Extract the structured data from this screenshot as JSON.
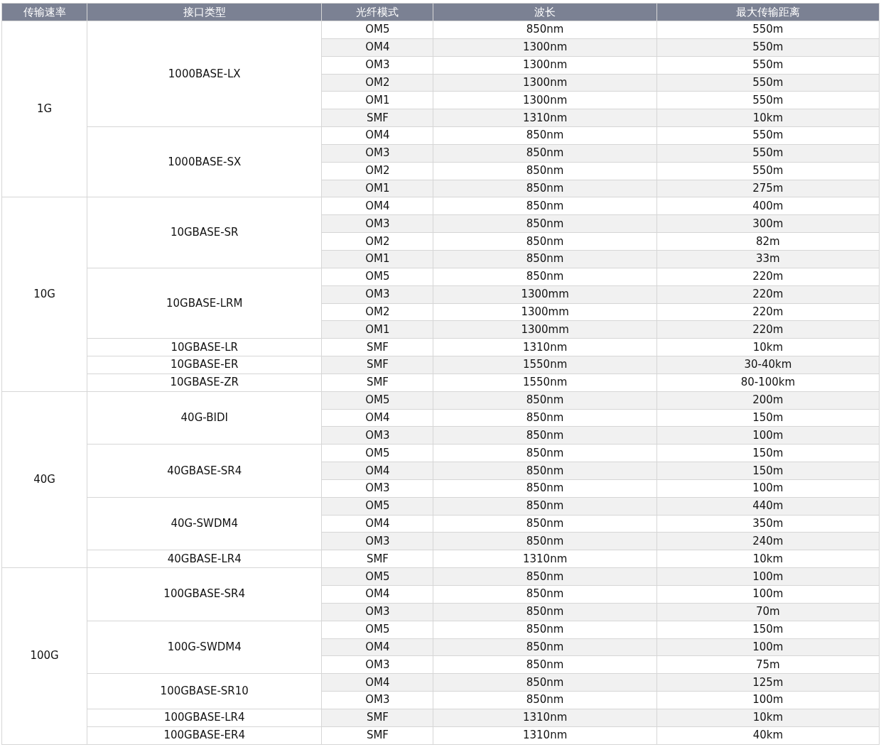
{
  "table": {
    "columns": [
      "传输速率",
      "接口类型",
      "光纤模式",
      "波长",
      "最大传输距离"
    ],
    "groups": [
      {
        "speed": "1G",
        "interfaces": [
          {
            "name": "1000BASE-LX",
            "modes": [
              [
                "OM5",
                "850nm",
                "550m"
              ],
              [
                "OM4",
                "1300nm",
                "550m"
              ],
              [
                "OM3",
                "1300nm",
                "550m"
              ],
              [
                "OM2",
                "1300nm",
                "550m"
              ],
              [
                "OM1",
                "1300nm",
                "550m"
              ],
              [
                "SMF",
                "1310nm",
                "10km"
              ]
            ]
          },
          {
            "name": "1000BASE-SX",
            "modes": [
              [
                "OM4",
                "850nm",
                "550m"
              ],
              [
                "OM3",
                "850nm",
                "550m"
              ],
              [
                "OM2",
                "850nm",
                "550m"
              ],
              [
                "OM1",
                "850nm",
                "275m"
              ]
            ]
          }
        ]
      },
      {
        "speed": "10G",
        "interfaces": [
          {
            "name": "10GBASE-SR",
            "modes": [
              [
                "OM4",
                "850nm",
                "400m"
              ],
              [
                "OM3",
                "850nm",
                "300m"
              ],
              [
                "OM2",
                "850nm",
                "82m"
              ],
              [
                "OM1",
                "850nm",
                "33m"
              ]
            ]
          },
          {
            "name": "10GBASE-LRM",
            "modes": [
              [
                "OM5",
                "850nm",
                "220m"
              ],
              [
                "OM3",
                "1300mm",
                "220m"
              ],
              [
                "OM2",
                "1300mm",
                "220m"
              ],
              [
                "OM1",
                "1300mm",
                "220m"
              ]
            ]
          },
          {
            "name": "10GBASE-LR",
            "modes": [
              [
                "SMF",
                "1310nm",
                "10km"
              ]
            ]
          },
          {
            "name": "10GBASE-ER",
            "modes": [
              [
                "SMF",
                "1550nm",
                "30-40km"
              ]
            ]
          },
          {
            "name": "10GBASE-ZR",
            "modes": [
              [
                "SMF",
                "1550nm",
                "80-100km"
              ]
            ]
          }
        ]
      },
      {
        "speed": "40G",
        "interfaces": [
          {
            "name": "40G-BIDI",
            "modes": [
              [
                "OM5",
                "850nm",
                "200m"
              ],
              [
                "OM4",
                "850nm",
                "150m"
              ],
              [
                "OM3",
                "850nm",
                "100m"
              ]
            ]
          },
          {
            "name": "40GBASE-SR4",
            "modes": [
              [
                "OM5",
                "850nm",
                "150m"
              ],
              [
                "OM4",
                "850nm",
                "150m"
              ],
              [
                "OM3",
                "850nm",
                "100m"
              ]
            ]
          },
          {
            "name": "40G-SWDM4",
            "modes": [
              [
                "OM5",
                "850nm",
                "440m"
              ],
              [
                "OM4",
                "850nm",
                "350m"
              ],
              [
                "OM3",
                "850nm",
                "240m"
              ]
            ]
          },
          {
            "name": "40GBASE-LR4",
            "modes": [
              [
                "SMF",
                "1310nm",
                "10km"
              ]
            ]
          }
        ]
      },
      {
        "speed": "100G",
        "interfaces": [
          {
            "name": "100GBASE-SR4",
            "modes": [
              [
                "OM5",
                "850nm",
                "100m"
              ],
              [
                "OM4",
                "850nm",
                "100m"
              ],
              [
                "OM3",
                "850nm",
                "70m"
              ]
            ]
          },
          {
            "name": "100G-SWDM4",
            "modes": [
              [
                "OM5",
                "850nm",
                "150m"
              ],
              [
                "OM4",
                "850nm",
                "100m"
              ],
              [
                "OM3",
                "850nm",
                "75m"
              ]
            ]
          },
          {
            "name": "100GBASE-SR10",
            "modes": [
              [
                "OM4",
                "850nm",
                "125m"
              ],
              [
                "OM3",
                "850nm",
                "100m"
              ]
            ]
          },
          {
            "name": "100GBASE-LR4",
            "modes": [
              [
                "SMF",
                "1310nm",
                "10km"
              ]
            ]
          },
          {
            "name": "100GBASE-ER4",
            "modes": [
              [
                "SMF",
                "1310nm",
                "40km"
              ]
            ]
          }
        ]
      }
    ]
  }
}
